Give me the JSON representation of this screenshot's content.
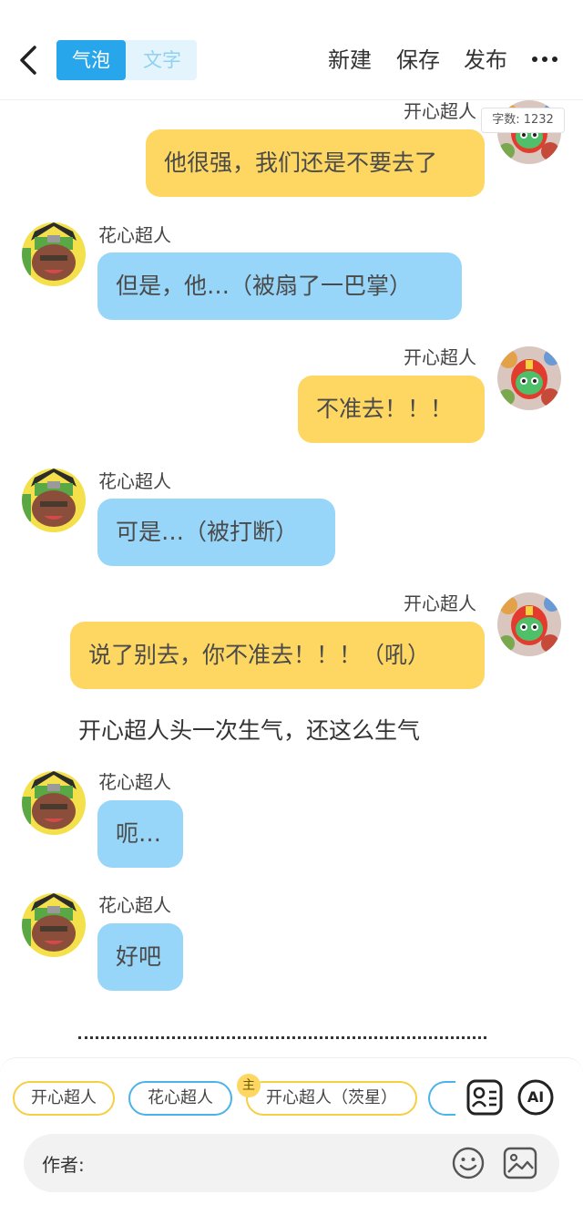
{
  "header": {
    "tab_bubble": "气泡",
    "tab_text": "文字",
    "new_label": "新建",
    "save_label": "保存",
    "publish_label": "发布"
  },
  "word_count": "字数: 1232",
  "messages": [
    {
      "speaker": "开心超人",
      "text": "他很强，我们还是不要去了"
    },
    {
      "speaker": "花心超人",
      "text": "但是，他…（被扇了一巴掌）"
    },
    {
      "speaker": "开心超人",
      "text": "不准去！！！"
    },
    {
      "speaker": "花心超人",
      "text": "可是…（被打断）"
    },
    {
      "speaker": "开心超人",
      "text": "说了别去，你不准去！！！（吼）"
    },
    {
      "speaker": "花心超人",
      "text": "呃…"
    },
    {
      "speaker": "花心超人",
      "text": "好吧"
    }
  ],
  "narration": "开心超人头一次生气，还这么生气",
  "characters": [
    {
      "name": "开心超人"
    },
    {
      "name": "花心超人"
    },
    {
      "name": "开心超人（茨星）",
      "badge": "主"
    }
  ],
  "icons": {
    "contact": "contact-card-icon",
    "ai": "AI"
  },
  "input": {
    "author_label": "作者:"
  },
  "colors": {
    "accent_blue": "#27a6ec",
    "bubble_yellow": "#fdd762",
    "bubble_blue": "#97d6f9"
  }
}
